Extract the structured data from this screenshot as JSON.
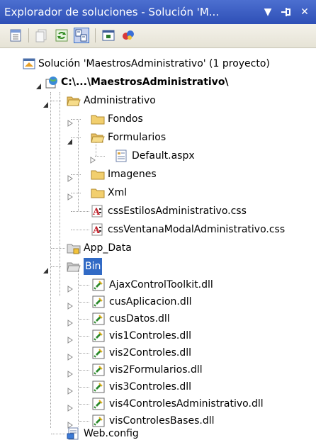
{
  "window": {
    "title": "Explorador de soluciones - Solución 'M...",
    "dropdown_glyph": "▼",
    "pin_glyph": "⊣",
    "close_glyph": "✕"
  },
  "toolbar": {
    "buttons": [
      "properties-icon",
      "show-all-files-icon",
      "refresh-icon",
      "nest-related-files-icon",
      "view-code-icon",
      "class-diagram-icon"
    ]
  },
  "tree": {
    "solution": "Solución 'MaestrosAdministrativo' (1 proyecto)",
    "project": "C:\\...\\MaestrosAdministrativo\\",
    "administrativo": "Administrativo",
    "fondos": "Fondos",
    "formularios": "Formularios",
    "default": "Default.aspx",
    "imagenes": "Imagenes",
    "xml": "Xml",
    "css1": "cssEstilosAdministrativo.css",
    "css2": "cssVentanaModalAdministrativo.css",
    "app_data": "App_Data",
    "bin": "Bin",
    "dlls": [
      "AjaxControlToolkit.dll",
      "cusAplicacion.dll",
      "cusDatos.dll",
      "vis1Controles.dll",
      "vis2Controles.dll",
      "vis2Formularios.dll",
      "vis3Controles.dll",
      "vis4ControlesAdministrativo.dll",
      "visControlesBases.dll"
    ],
    "webconfig": "Web.config"
  }
}
